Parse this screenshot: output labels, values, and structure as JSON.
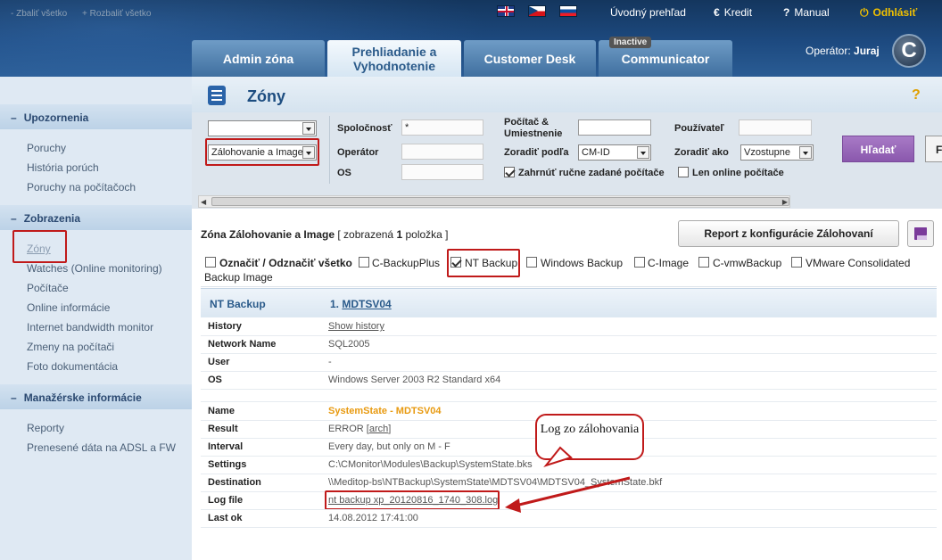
{
  "topnav": {
    "home": "Úvodný prehľad",
    "credit_icon": "€",
    "credit": "Kredit",
    "manual_icon": "?",
    "manual": "Manual",
    "logout_icon": "⏻",
    "logout": "Odhlásiť",
    "flags": [
      "uk-flag-icon",
      "cz-flag-icon",
      "sk-flag-icon"
    ]
  },
  "tabs": [
    {
      "label": "Admin zóna"
    },
    {
      "label": "Prehliadanie a Vyhodnotenie"
    },
    {
      "label": "Customer Desk"
    },
    {
      "label": "Communicator",
      "badge": "Inactive"
    }
  ],
  "operator": {
    "label": "Operátor:",
    "name": "Juraj",
    "logo": "C"
  },
  "sidebar": {
    "collapse_all": "- Zbaliť všetko",
    "expand_all": "+ Rozbaliť všetko",
    "sections": [
      {
        "title": "Upozornenia",
        "items": [
          "Poruchy",
          "História porúch",
          "Poruchy na počítačoch"
        ]
      },
      {
        "title": "Zobrazenia",
        "items": [
          "Zóny",
          "Watches (Online monitoring)",
          "Počítače",
          "Online informácie",
          "Internet bandwidth monitor",
          "Zmeny na počítači",
          "Foto dokumentácia"
        ]
      },
      {
        "title": "Manažérske informácie",
        "items": [
          "Reporty",
          "Prenesené dáta na ADSL a FW"
        ]
      }
    ]
  },
  "page": {
    "title": "Zóny",
    "help": "?"
  },
  "filter": {
    "select1": "",
    "select2": "Zálohovanie a Image",
    "spolocnost_label": "Spoločnosť",
    "spolocnost_value": "*",
    "operator_label": "Operátor",
    "os_label": "OS",
    "pocitac_label": "Počítač & Umiestnenie",
    "zoradit_label": "Zoradiť podľa",
    "zoradit_value": "CM-ID",
    "include_manual": "Zahrnúť ručne zadané počítače",
    "uzivatel_label": "Používateľ",
    "zoradit_ako_label": "Zoradiť ako",
    "zoradit_ako_value": "Vzostupne",
    "online_only": "Len online počítače",
    "search_button": "Hľadať",
    "next_button": "F",
    "include_manual_checked": true,
    "online_only_checked": false
  },
  "zone": {
    "title_prefix": "Zóna Zálohovanie a Image",
    "title_suffix_open": "[ zobrazená",
    "count": "1",
    "title_suffix_close": "položka ]",
    "report_button": "Report z konfigurácie Zálohovaní",
    "checkboxes": [
      {
        "label": "Označiť / Odznačiť všetko",
        "checked": false
      },
      {
        "label": "C-BackupPlus",
        "checked": false
      },
      {
        "label": "NT Backup",
        "checked": true
      },
      {
        "label": "Windows Backup",
        "checked": false
      },
      {
        "label": "C-Image",
        "checked": false
      },
      {
        "label": "C-vmwBackup",
        "checked": false
      },
      {
        "label": "VMware Consolidated",
        "checked": false
      }
    ],
    "checkbox_wrap": "Backup Image"
  },
  "card": {
    "type": "NT Backup",
    "index": "1.",
    "computer": "MDTSV04",
    "rows1": [
      {
        "label": "History",
        "value": "Show history"
      },
      {
        "label": "Network Name",
        "value": "SQL2005"
      },
      {
        "label": "User",
        "value": "-"
      },
      {
        "label": "OS",
        "value": "Windows Server 2003 R2 Standard x64"
      }
    ],
    "rows2": [
      {
        "label": "Name",
        "value": "SystemState - MDTSV04"
      },
      {
        "label": "Result",
        "value": "ERROR",
        "link": "arch"
      },
      {
        "label": "Interval",
        "value": "Every day, but only on M - F"
      },
      {
        "label": "Settings",
        "value": "C:\\CMonitor\\Modules\\Backup\\SystemState.bks"
      },
      {
        "label": "Destination",
        "value": "\\\\Meditop-bs\\NTBackup\\SystemState\\MDTSV04\\MDTSV04_SystemState.bkf"
      },
      {
        "label": "Log file",
        "value": "nt backup xp_20120816_1740_308.log"
      },
      {
        "label": "Last ok",
        "value": "14.08.2012 17:41:00"
      }
    ]
  },
  "annotation": {
    "callout": "Log zo zálohovania"
  },
  "colors": {
    "highlight": "#c01a1a",
    "accent_purple": "#8a58ad",
    "header_blue": "#1d4a80"
  }
}
